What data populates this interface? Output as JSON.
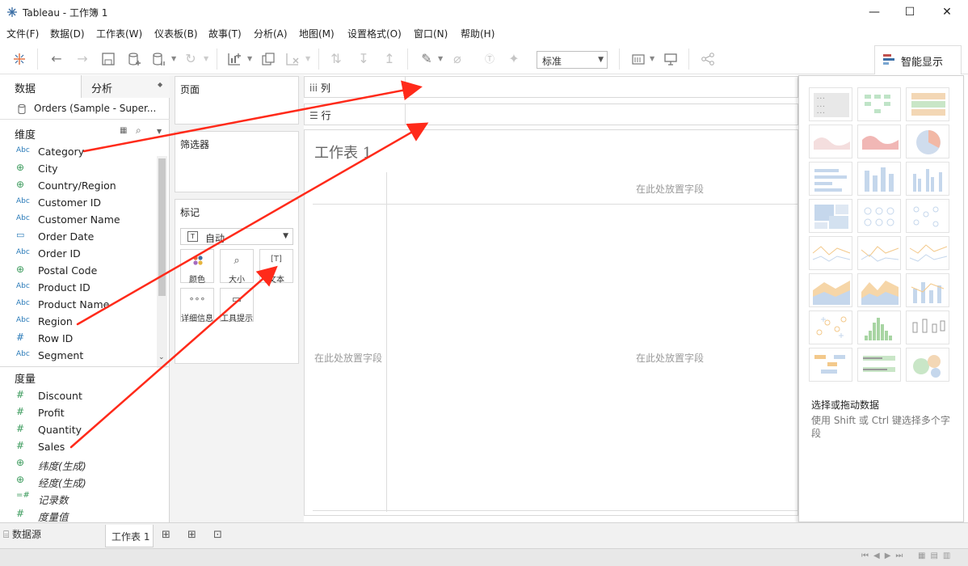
{
  "window": {
    "title": "Tableau - 工作簿 1",
    "minimize": "—",
    "maximize": "☐",
    "close": "✕"
  },
  "menu": [
    "文件(F)",
    "数据(D)",
    "工作表(W)",
    "仪表板(B)",
    "故事(T)",
    "分析(A)",
    "地图(M)",
    "设置格式(O)",
    "窗口(N)",
    "帮助(H)"
  ],
  "toolbar": {
    "fit_value": "标准"
  },
  "showme": {
    "tab_label": "智能显示",
    "hint_title": "选择或拖动数据",
    "hint_body": "使用 Shift 或 Ctrl 键选择多个字段"
  },
  "datapane": {
    "tab_data": "数据",
    "tab_analysis": "分析",
    "datasource": "Orders (Sample - Super...",
    "dimensions_label": "维度",
    "measures_label": "度量",
    "dimensions": [
      {
        "type": "Abc",
        "name": "Category"
      },
      {
        "type": "geo",
        "name": "City"
      },
      {
        "type": "geo",
        "name": "Country/Region"
      },
      {
        "type": "Abc",
        "name": "Customer ID"
      },
      {
        "type": "Abc",
        "name": "Customer Name"
      },
      {
        "type": "date",
        "name": "Order Date"
      },
      {
        "type": "Abc",
        "name": "Order ID"
      },
      {
        "type": "geo",
        "name": "Postal Code"
      },
      {
        "type": "Abc",
        "name": "Product ID"
      },
      {
        "type": "Abc",
        "name": "Product Name"
      },
      {
        "type": "Abc",
        "name": "Region"
      },
      {
        "type": "#",
        "name": "Row ID"
      },
      {
        "type": "Abc",
        "name": "Segment"
      }
    ],
    "measures": [
      {
        "type": "#",
        "name": "Discount",
        "italic": false
      },
      {
        "type": "#",
        "name": "Profit",
        "italic": false
      },
      {
        "type": "#",
        "name": "Quantity",
        "italic": false
      },
      {
        "type": "#",
        "name": "Sales",
        "italic": false
      },
      {
        "type": "geo",
        "name": "纬度(生成)",
        "italic": true
      },
      {
        "type": "geo",
        "name": "经度(生成)",
        "italic": true
      },
      {
        "type": "=#",
        "name": "记录数",
        "italic": true
      },
      {
        "type": "#",
        "name": "度量值",
        "italic": true
      }
    ]
  },
  "cards": {
    "pages": "页面",
    "filters": "筛选器",
    "marks": "标记",
    "mark_type": "自动",
    "mark_buttons": [
      "颜色",
      "大小",
      "文本",
      "详细信息",
      "工具提示"
    ]
  },
  "shelves": {
    "columns": "列",
    "rows": "行"
  },
  "view": {
    "sheet_title": "工作表 1",
    "drop_top": "在此处放置字段",
    "drop_left": "在此处放置字段",
    "drop_center": "在此处放置字段"
  },
  "bottom": {
    "datasource_tab": "数据源",
    "sheet_tab": "工作表 1"
  },
  "colors": {
    "arrow": "#ff2a1a",
    "accent_blue": "#2b7bb9",
    "measure_green": "#3a9a5b"
  }
}
